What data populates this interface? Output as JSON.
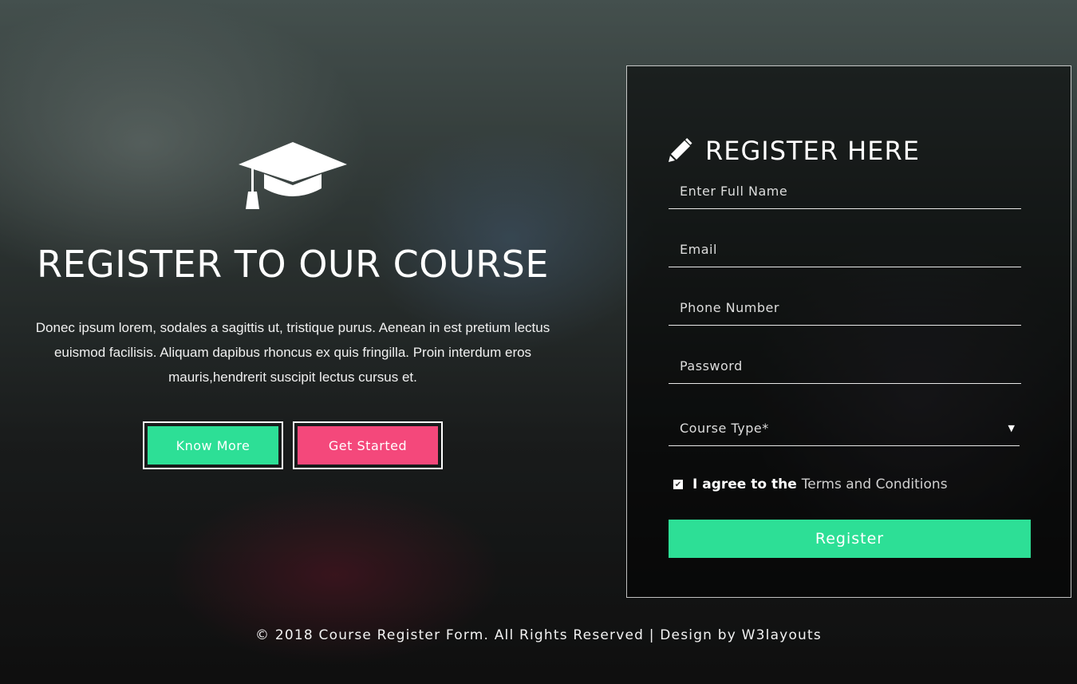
{
  "left": {
    "title": "REGISTER TO OUR COURSE",
    "description": "Donec ipsum lorem, sodales a sagittis ut, tristique purus. Aenean in est pretium lectus euismod facilisis. Aliquam dapibus rhoncus ex quis fringilla. Proin interdum eros mauris,hendrerit suscipit lectus cursus et.",
    "know_more_label": "Know More",
    "get_started_label": "Get Started"
  },
  "form": {
    "title": "REGISTER HERE",
    "full_name_placeholder": "Enter Full Name",
    "email_placeholder": "Email",
    "phone_placeholder": "Phone Number",
    "password_placeholder": "Password",
    "course_type_selected": "Course Type*",
    "agree_prefix": "I agree to the",
    "terms_link": "Terms and Conditions",
    "agree_checked": true,
    "register_label": "Register"
  },
  "footer": {
    "text": "© 2018 Course Register Form. All Rights Reserved | Design by W3layouts"
  },
  "icons": {
    "hero": "graduation-cap-icon",
    "form": "pencil-icon",
    "dropdown": "caret-down-icon"
  },
  "colors": {
    "accent_green": "#2ddf96",
    "accent_pink": "#f4487b"
  }
}
